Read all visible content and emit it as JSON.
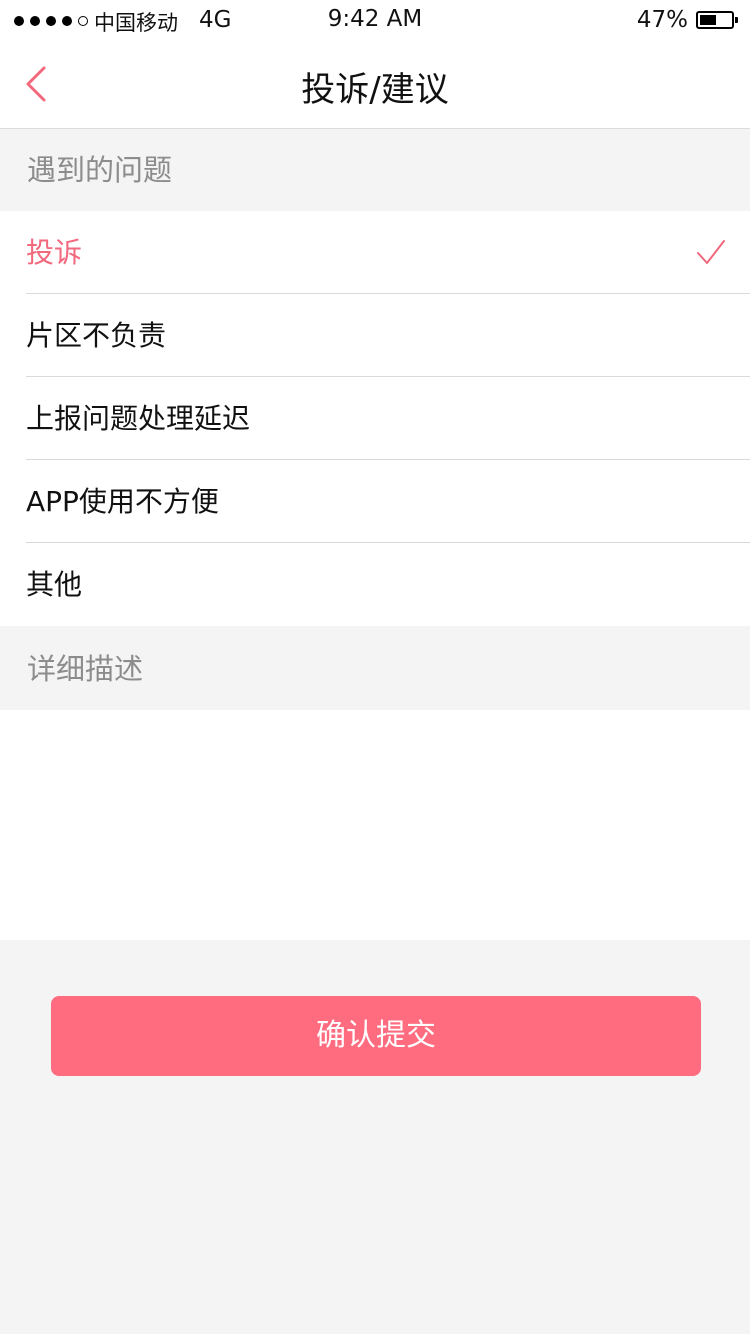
{
  "status_bar": {
    "carrier": "中国移动",
    "network": "4G",
    "time": "9:42 AM",
    "battery": "47%",
    "battery_level": 0.47,
    "signal_strength": 4,
    "signal_max": 5
  },
  "nav": {
    "title": "投诉/建议",
    "back_icon": "chevron-left-icon"
  },
  "issues_section": {
    "header": "遇到的问题",
    "options": [
      {
        "label": "投诉",
        "selected": true
      },
      {
        "label": "片区不负责",
        "selected": false
      },
      {
        "label": "上报问题处理延迟",
        "selected": false
      },
      {
        "label": "APP使用不方便",
        "selected": false
      },
      {
        "label": "其他",
        "selected": false
      }
    ],
    "check_icon": "checkmark-icon"
  },
  "details_section": {
    "header": "详细描述",
    "value": ""
  },
  "submit": {
    "label": "确认提交"
  },
  "colors": {
    "accent": "#f2687c",
    "button": "#ff6b7f",
    "background": "#f4f4f4",
    "section_text": "#8c8c8c"
  }
}
